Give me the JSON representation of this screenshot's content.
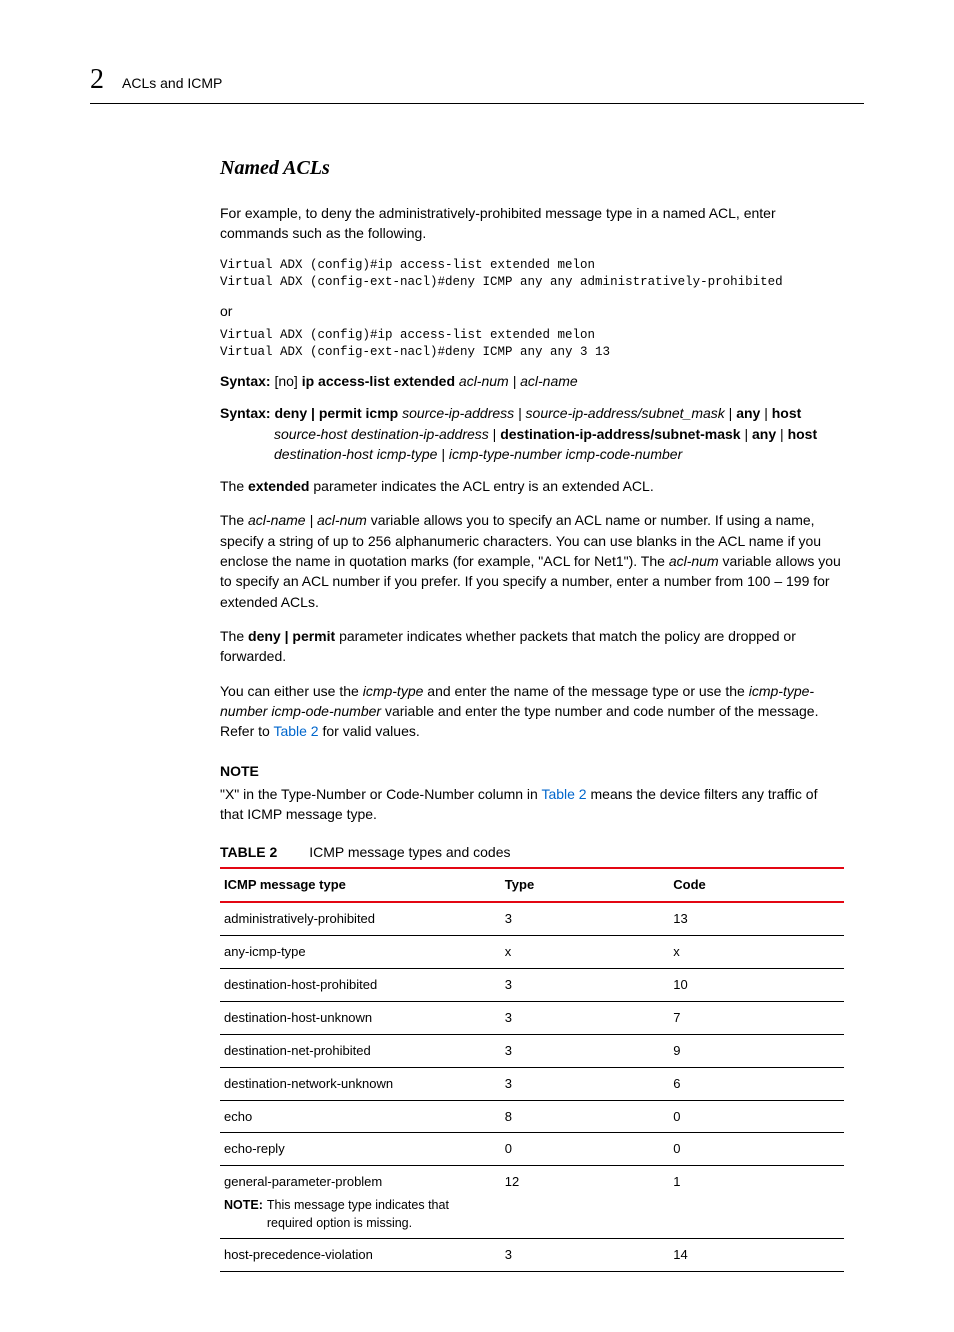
{
  "header": {
    "chapter": "2",
    "title": "ACLs and ICMP"
  },
  "section": {
    "title": "Named ACLs",
    "intro": "For example, to deny the administratively-prohibited message type in a named ACL, enter commands such as the following.",
    "code1": "Virtual ADX (config)#ip access-list extended melon\nVirtual ADX (config-ext-nacl)#deny ICMP any any administratively-prohibited",
    "or": "or",
    "code2": "Virtual ADX (config)#ip access-list extended melon\nVirtual ADX (config-ext-nacl)#deny ICMP any any 3 13",
    "syntax1": {
      "label": "Syntax:",
      "pre": " [no] ",
      "bold": "ip access-list extended ",
      "italic": "acl-num | acl-name"
    },
    "syntax2": {
      "label": "Syntax:",
      "bold1": " deny | permit icmp ",
      "it1": "source-ip-address | source-ip-address/subnet_mask",
      "sep1": " | ",
      "bold2": "any",
      "sep2": " | ",
      "bold3": "host",
      "line2_it1": "source-host destination-ip-address",
      "line2_sep1": " | ",
      "line2_b1": "destination-ip-address/subnet-mask",
      "line2_sep2": " | ",
      "line2_b2": "any",
      "line2_sep3": " | ",
      "line2_b3": "host",
      "line3_it": "destination-host icmp-type | icmp-type-number icmp-code-number"
    },
    "para_extended_pre": "The ",
    "para_extended_bold": "extended",
    "para_extended_post": " parameter indicates the ACL entry is an extended ACL.",
    "para_aclname_1": "The ",
    "para_aclname_it1": "acl-name | acl-num",
    "para_aclname_2": " variable allows you to specify an ACL name or number. If using a name, specify a string of up to 256 alphanumeric characters. You can use blanks in the ACL name if you enclose the name in quotation marks (for example, \"ACL for Net1\"). The ",
    "para_aclname_it2": "acl-num",
    "para_aclname_3": " variable allows you to specify an ACL number if you prefer. If you specify a number, enter a number from 100 – 199 for extended ACLs.",
    "para_deny_pre": "The ",
    "para_deny_bold": "deny | permit",
    "para_deny_post": " parameter indicates whether packets that match the policy are dropped or forwarded.",
    "para_icmp_1": "You can either use the ",
    "para_icmp_it1": "icmp-type",
    "para_icmp_2": " and enter the name of the message type or use the ",
    "para_icmp_it2": "icmp-type-number icmp-ode-number",
    "para_icmp_3": " variable and enter the type number and code number of the message. Refer to ",
    "para_icmp_link": "Table 2",
    "para_icmp_4": " for valid values.",
    "note_heading": "NOTE",
    "note_1": "\"X\" in the Type-Number or Code-Number column in ",
    "note_link": "Table 2",
    "note_2": " means the device filters any traffic of that ICMP message type."
  },
  "table": {
    "label": "TABLE 2",
    "title": "ICMP message types and codes",
    "headers": {
      "c1": "ICMP message type",
      "c2": "Type",
      "c3": "Code"
    },
    "rows": [
      {
        "msg": "administratively-prohibited",
        "type": "3",
        "code": "13",
        "note": ""
      },
      {
        "msg": "any-icmp-type",
        "type": "x",
        "code": "x",
        "note": ""
      },
      {
        "msg": "destination-host-prohibited",
        "type": "3",
        "code": "10",
        "note": ""
      },
      {
        "msg": "destination-host-unknown",
        "type": "3",
        "code": "7",
        "note": ""
      },
      {
        "msg": "destination-net-prohibited",
        "type": "3",
        "code": "9",
        "note": ""
      },
      {
        "msg": "destination-network-unknown",
        "type": "3",
        "code": "6",
        "note": ""
      },
      {
        "msg": "echo",
        "type": "8",
        "code": "0",
        "note": ""
      },
      {
        "msg": "echo-reply",
        "type": "0",
        "code": "0",
        "note": ""
      },
      {
        "msg": "general-parameter-problem",
        "type": "12",
        "code": "1",
        "note": "This message type indicates that required option is missing."
      },
      {
        "msg": "host-precedence-violation",
        "type": "3",
        "code": "14",
        "note": ""
      }
    ],
    "note_label": "NOTE:"
  }
}
